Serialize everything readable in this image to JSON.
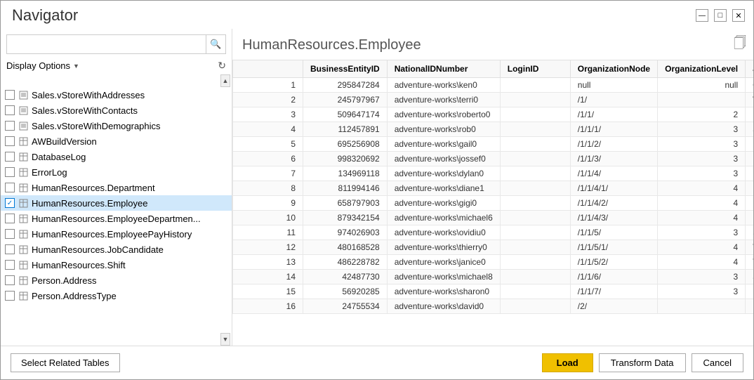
{
  "window": {
    "title": "Navigator"
  },
  "left_panel": {
    "search_placeholder": "",
    "display_options_label": "Display Options",
    "tree_items": [
      {
        "id": "sales-vstore-addresses",
        "label": "Sales.vStoreWithAddresses",
        "type": "view",
        "checked": false,
        "selected": false
      },
      {
        "id": "sales-vstore-contacts",
        "label": "Sales.vStoreWithContacts",
        "type": "view",
        "checked": false,
        "selected": false
      },
      {
        "id": "sales-vstore-demographics",
        "label": "Sales.vStoreWithDemographics",
        "type": "view",
        "checked": false,
        "selected": false
      },
      {
        "id": "awbuildversion",
        "label": "AWBuildVersion",
        "type": "table",
        "checked": false,
        "selected": false
      },
      {
        "id": "databaselog",
        "label": "DatabaseLog",
        "type": "table",
        "checked": false,
        "selected": false
      },
      {
        "id": "errorlog",
        "label": "ErrorLog",
        "type": "table",
        "checked": false,
        "selected": false
      },
      {
        "id": "hr-department",
        "label": "HumanResources.Department",
        "type": "table",
        "checked": false,
        "selected": false
      },
      {
        "id": "hr-employee",
        "label": "HumanResources.Employee",
        "type": "table",
        "checked": true,
        "selected": true
      },
      {
        "id": "hr-employeedepartment",
        "label": "HumanResources.EmployeeDepartmen...",
        "type": "table",
        "checked": false,
        "selected": false
      },
      {
        "id": "hr-employeepayhistory",
        "label": "HumanResources.EmployeePayHistory",
        "type": "table",
        "checked": false,
        "selected": false
      },
      {
        "id": "hr-jobcandidate",
        "label": "HumanResources.JobCandidate",
        "type": "table",
        "checked": false,
        "selected": false
      },
      {
        "id": "hr-shift",
        "label": "HumanResources.Shift",
        "type": "table",
        "checked": false,
        "selected": false
      },
      {
        "id": "person-address",
        "label": "Person.Address",
        "type": "table",
        "checked": false,
        "selected": false
      },
      {
        "id": "person-addresstype",
        "label": "Person.AddressType",
        "type": "table",
        "checked": false,
        "selected": false
      }
    ]
  },
  "right_panel": {
    "title": "HumanResources.Employee",
    "columns": [
      "BusinessEntityID",
      "NationalIDNumber",
      "LoginID",
      "OrganizationNode",
      "OrganizationLevel",
      "JobTitl"
    ],
    "rows": [
      {
        "num": 1,
        "BusinessEntityID": "295847284",
        "NationalIDNumber": "adventure-works\\ken0",
        "LoginID": "",
        "OrganizationNode": "null",
        "OrganizationLevel": "null",
        "JobTitl": "Chi"
      },
      {
        "num": 2,
        "BusinessEntityID": "245797967",
        "NationalIDNumber": "adventure-works\\terri0",
        "LoginID": "",
        "OrganizationNode": "/1/",
        "OrganizationLevel": "",
        "JobTitl": "Vice"
      },
      {
        "num": 3,
        "BusinessEntityID": "509647174",
        "NationalIDNumber": "adventure-works\\roberto0",
        "LoginID": "",
        "OrganizationNode": "/1/1/",
        "OrganizationLevel": "2",
        "JobTitl": "Eng"
      },
      {
        "num": 4,
        "BusinessEntityID": "112457891",
        "NationalIDNumber": "adventure-works\\rob0",
        "LoginID": "",
        "OrganizationNode": "/1/1/1/",
        "OrganizationLevel": "3",
        "JobTitl": "Sen"
      },
      {
        "num": 5,
        "BusinessEntityID": "695256908",
        "NationalIDNumber": "adventure-works\\gail0",
        "LoginID": "",
        "OrganizationNode": "/1/1/2/",
        "OrganizationLevel": "3",
        "JobTitl": "Des"
      },
      {
        "num": 6,
        "BusinessEntityID": "998320692",
        "NationalIDNumber": "adventure-works\\jossef0",
        "LoginID": "",
        "OrganizationNode": "/1/1/3/",
        "OrganizationLevel": "3",
        "JobTitl": "Des"
      },
      {
        "num": 7,
        "BusinessEntityID": "134969118",
        "NationalIDNumber": "adventure-works\\dylan0",
        "LoginID": "",
        "OrganizationNode": "/1/1/4/",
        "OrganizationLevel": "3",
        "JobTitl": "Res"
      },
      {
        "num": 8,
        "BusinessEntityID": "811994146",
        "NationalIDNumber": "adventure-works\\diane1",
        "LoginID": "",
        "OrganizationNode": "/1/1/4/1/",
        "OrganizationLevel": "4",
        "JobTitl": "Res"
      },
      {
        "num": 9,
        "BusinessEntityID": "658797903",
        "NationalIDNumber": "adventure-works\\gigi0",
        "LoginID": "",
        "OrganizationNode": "/1/1/4/2/",
        "OrganizationLevel": "4",
        "JobTitl": "Res"
      },
      {
        "num": 10,
        "BusinessEntityID": "879342154",
        "NationalIDNumber": "adventure-works\\michael6",
        "LoginID": "",
        "OrganizationNode": "/1/1/4/3/",
        "OrganizationLevel": "4",
        "JobTitl": "Res"
      },
      {
        "num": 11,
        "BusinessEntityID": "974026903",
        "NationalIDNumber": "adventure-works\\ovidiu0",
        "LoginID": "",
        "OrganizationNode": "/1/1/5/",
        "OrganizationLevel": "3",
        "JobTitl": "Sen"
      },
      {
        "num": 12,
        "BusinessEntityID": "480168528",
        "NationalIDNumber": "adventure-works\\thierry0",
        "LoginID": "",
        "OrganizationNode": "/1/1/5/1/",
        "OrganizationLevel": "4",
        "JobTitl": "Too"
      },
      {
        "num": 13,
        "BusinessEntityID": "486228782",
        "NationalIDNumber": "adventure-works\\janice0",
        "LoginID": "",
        "OrganizationNode": "/1/1/5/2/",
        "OrganizationLevel": "4",
        "JobTitl": "Too"
      },
      {
        "num": 14,
        "BusinessEntityID": "42487730",
        "NationalIDNumber": "adventure-works\\michael8",
        "LoginID": "",
        "OrganizationNode": "/1/1/6/",
        "OrganizationLevel": "3",
        "JobTitl": "Sen"
      },
      {
        "num": 15,
        "BusinessEntityID": "56920285",
        "NationalIDNumber": "adventure-works\\sharon0",
        "LoginID": "",
        "OrganizationNode": "/1/1/7/",
        "OrganizationLevel": "3",
        "JobTitl": "Des"
      },
      {
        "num": 16,
        "BusinessEntityID": "24755534",
        "NationalIDNumber": "adventure-works\\david0",
        "LoginID": "",
        "OrganizationNode": "/2/",
        "OrganizationLevel": "",
        "JobTitl": "Ma"
      }
    ]
  },
  "bottom_bar": {
    "select_related_tables_label": "Select Related Tables",
    "load_label": "Load",
    "transform_data_label": "Transform Data",
    "cancel_label": "Cancel"
  }
}
